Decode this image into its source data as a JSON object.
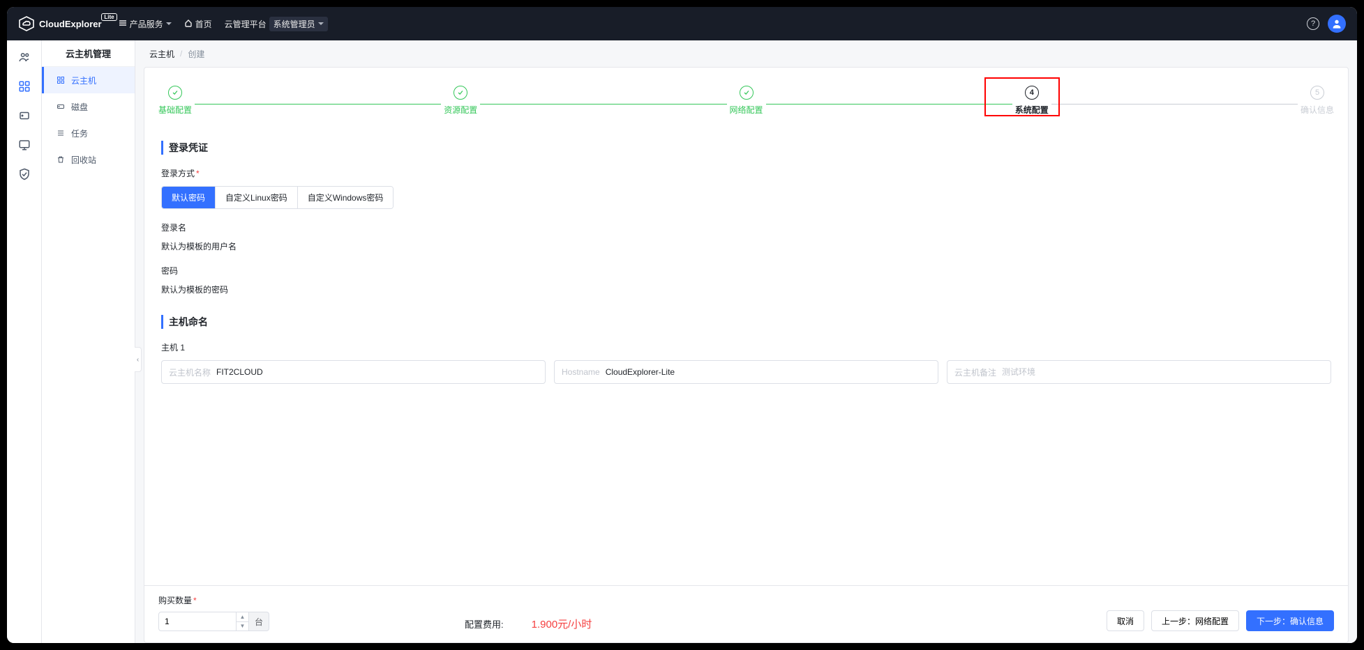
{
  "header": {
    "logo_text": "CloudExplorer",
    "logo_badge": "Lite",
    "nav_products": "产品服务",
    "nav_home": "首页",
    "nav_platform": "云管理平台",
    "nav_role": "系统管理员"
  },
  "sidebar": {
    "title": "云主机管理",
    "items": [
      {
        "label": "云主机"
      },
      {
        "label": "磁盘"
      },
      {
        "label": "任务"
      },
      {
        "label": "回收站"
      }
    ]
  },
  "breadcrumb": {
    "root": "云主机",
    "current": "创建"
  },
  "steps": {
    "s1": "基础配置",
    "s2": "资源配置",
    "s3": "网络配置",
    "s4_num": "4",
    "s4": "系统配置",
    "s5_num": "5",
    "s5": "确认信息"
  },
  "sections": {
    "credentials_title": "登录凭证",
    "login_method_label": "登录方式",
    "login_options": {
      "default_pw": "默认密码",
      "custom_linux": "自定义Linux密码",
      "custom_windows": "自定义Windows密码"
    },
    "login_name_label": "登录名",
    "login_name_value": "默认为模板的用户名",
    "password_label": "密码",
    "password_value": "默认为模板的密码",
    "hostname_title": "主机命名",
    "host1_label": "主机 1",
    "host_name_tag": "云主机名称",
    "host_name_value": "FIT2CLOUD",
    "hostname_tag": "Hostname",
    "hostname_value": "CloudExplorer-Lite",
    "remark_tag": "云主机备注",
    "remark_placeholder": "测试环境"
  },
  "footer": {
    "qty_label": "购买数量",
    "qty_value": "1",
    "qty_unit": "台",
    "cost_label": "配置费用:",
    "cost_value": "1.900元/小时",
    "cancel": "取消",
    "prev": "上一步：网络配置",
    "next": "下一步：确认信息"
  }
}
